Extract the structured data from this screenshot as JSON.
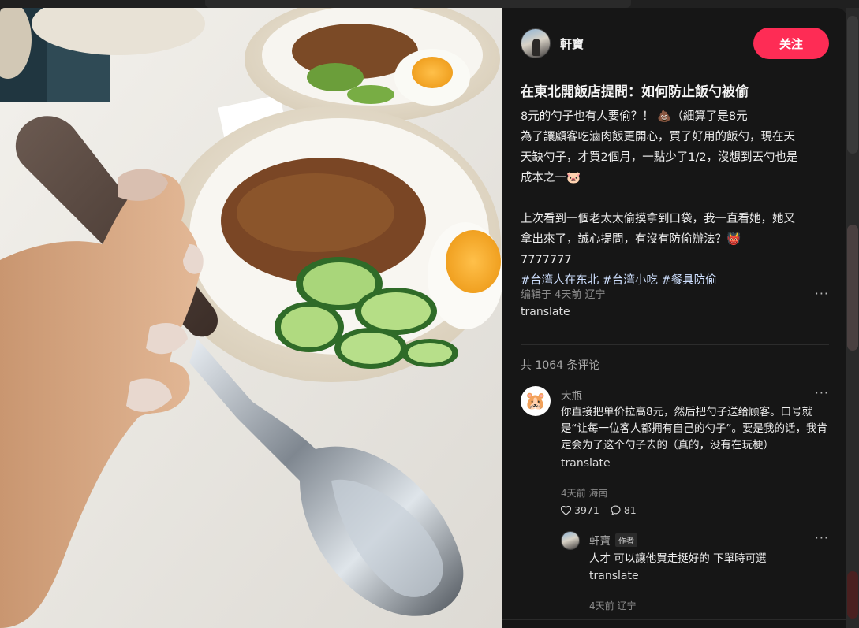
{
  "post": {
    "author_name": "軒寶",
    "follow_label": "关注",
    "title": "在東北開飯店提問：如何防止飯勺被偷",
    "body_lines": [
      "8元的勺子也有人要偷？！ 💩（細算了是8元",
      "為了讓顧客吃滷肉飯更開心，買了好用的飯勺，現在天",
      "天缺勺子，才買2個月，一點少了1/2，沒想到丟勺也是",
      "成本之一🐷",
      "上次看到一個老太太偷摸拿到口袋，我一直看她，她又",
      "拿出來了，誠心提問，有沒有防偷辦法？👹",
      "7777777"
    ],
    "tags": [
      "#台湾人在东北",
      "#台湾小吃",
      "#餐具防偷"
    ],
    "edited_meta": "编辑于 4天前 辽宁",
    "more_label": "···",
    "translate_label": "translate"
  },
  "comments": {
    "count_label": "共 1064 条评论",
    "items": [
      {
        "avatar_emoji": "🐹",
        "name": "大瓶",
        "text": "你直接把单价拉高8元，然后把勺子送给顾客。口号就是“让每一位客人都拥有自己的勺子”。要是我的话，我肯定会为了这个勺子去的（真的，没有在玩梗）",
        "translate_label": "translate",
        "meta": "4天前 海南",
        "likes": "3971",
        "replies": "81",
        "more_label": "···"
      }
    ],
    "reply": {
      "name": "軒寶",
      "badge": "作者",
      "text": "人才 可以讓他買走挺好的 下單時可選",
      "translate_label": "translate",
      "meta": "4天前 辽宁",
      "more_label": "···"
    }
  },
  "colors": {
    "accent": "#fe2c55",
    "panel_bg": "#161616"
  }
}
